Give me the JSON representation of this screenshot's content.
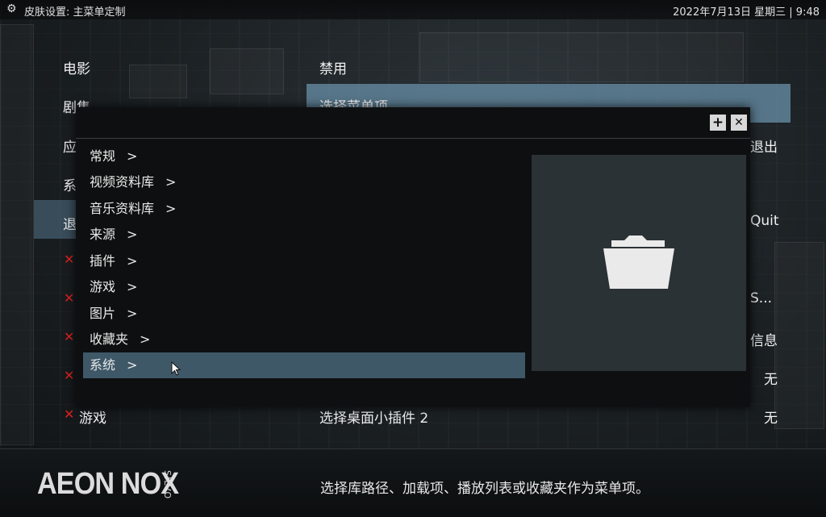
{
  "topbar": {
    "title": "皮肤设置: 主菜单定制",
    "datetime": "2022年7月13日 星期三 | 9:48"
  },
  "left_menu": {
    "items": [
      "电影",
      "剧集",
      "应",
      "系",
      "退"
    ],
    "bottom_item": "游戏"
  },
  "middle": {
    "disabled_label": "禁用",
    "choose_label": "选择菜单项",
    "widget_label": "选择桌面小插件 2"
  },
  "right_col": {
    "exit": "退出",
    "quit": "Quit",
    "truncated": "S...",
    "info": "信息",
    "none_1": "无",
    "none_2": "无"
  },
  "dialog": {
    "add_icon": "+",
    "close_icon": "✕",
    "items": [
      {
        "label": "常规",
        "chev": ">"
      },
      {
        "label": "视频资料库",
        "chev": ">"
      },
      {
        "label": "音乐资料库",
        "chev": ">"
      },
      {
        "label": "来源",
        "chev": ">"
      },
      {
        "label": "插件",
        "chev": ">"
      },
      {
        "label": "游戏",
        "chev": ">"
      },
      {
        "label": "图片",
        "chev": ">"
      },
      {
        "label": "收藏夹",
        "chev": ">"
      },
      {
        "label": "系统",
        "chev": ">"
      }
    ],
    "preview_icon": "folder-icon"
  },
  "footer": {
    "logo": "AEON NOX",
    "logo_sub": "SILVO",
    "hint": "选择库路径、加载项、播放列表或收藏夹作为菜单项。"
  },
  "colors": {
    "highlight": "#3e5868",
    "middle_highlight": "#60849a",
    "close_x": "#e02020"
  }
}
